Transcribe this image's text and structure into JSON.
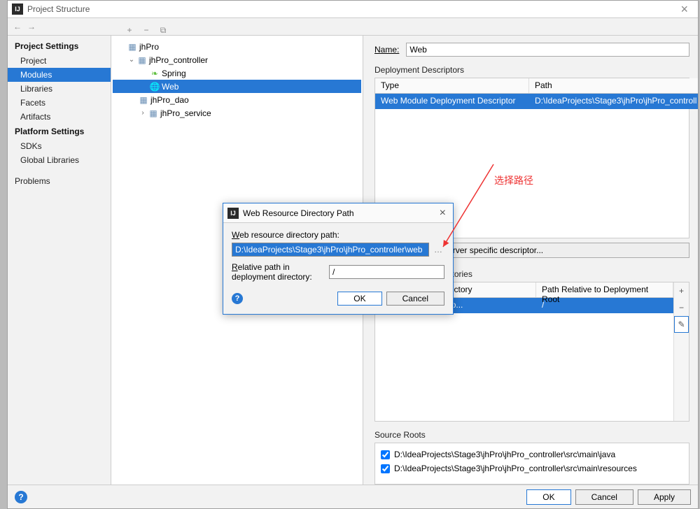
{
  "window_title": "Project Structure",
  "nav": {
    "back": "←",
    "forward": "→"
  },
  "sub_toolbar": {
    "add": "+",
    "remove": "−",
    "copy": "⧉"
  },
  "left": {
    "project_settings": "Project Settings",
    "items1": [
      "Project",
      "Modules",
      "Libraries",
      "Facets",
      "Artifacts"
    ],
    "platform_settings": "Platform Settings",
    "items2": [
      "SDKs",
      "Global Libraries"
    ],
    "problems": "Problems"
  },
  "tree": {
    "nodes": [
      {
        "indent": 0,
        "label": "jhPro",
        "expander": ""
      },
      {
        "indent": 0,
        "label": "jhPro_controller",
        "expander": "v"
      },
      {
        "indent": 2,
        "label": "Spring",
        "icon": "spring"
      },
      {
        "indent": 2,
        "label": "Web",
        "icon": "web",
        "selected": true
      },
      {
        "indent": 1,
        "label": "jhPro_dao",
        "expander": ""
      },
      {
        "indent": 1,
        "label": "jhPro_service",
        "expander": ">"
      }
    ]
  },
  "right": {
    "name_label": "Name:",
    "name_value": "Web",
    "descriptors": {
      "title": "Deployment Descriptors",
      "headers": [
        "Type",
        "Path"
      ],
      "rows": [
        {
          "type": "Web Module Deployment Descriptor",
          "path": "D:\\IdeaProjects\\Stage3\\jhPro\\jhPro_controll"
        }
      ],
      "add_specific": "Add Application Server specific descriptor..."
    },
    "resource_dirs": {
      "title": "Web Resource Directories",
      "headers": [
        "Web Resource Directory",
        "Path Relative to Deployment Root"
      ],
      "rows": [
        {
          "dir": "D:\\...\\jhPro\\jhPro_co...",
          "rel": "/"
        }
      ]
    },
    "source_roots": {
      "title": "Source Roots",
      "rows": [
        "D:\\IdeaProjects\\Stage3\\jhPro\\jhPro_controller\\src\\main\\java",
        "D:\\IdeaProjects\\Stage3\\jhPro\\jhPro_controller\\src\\main\\resources"
      ]
    }
  },
  "buttons": {
    "ok": "OK",
    "cancel": "Cancel",
    "apply": "Apply"
  },
  "modal": {
    "title": "Web Resource Directory Path",
    "path_label": "Web resource directory path:",
    "path_value": "D:\\IdeaProjects\\Stage3\\jhPro\\jhPro_controller\\web",
    "rel_label": "Relative path in deployment directory:",
    "rel_value": "/",
    "ok": "OK",
    "cancel": "Cancel"
  },
  "side_icons": {
    "plus": "+",
    "minus": "−",
    "edit": "✎"
  },
  "annotation": "选择路径"
}
